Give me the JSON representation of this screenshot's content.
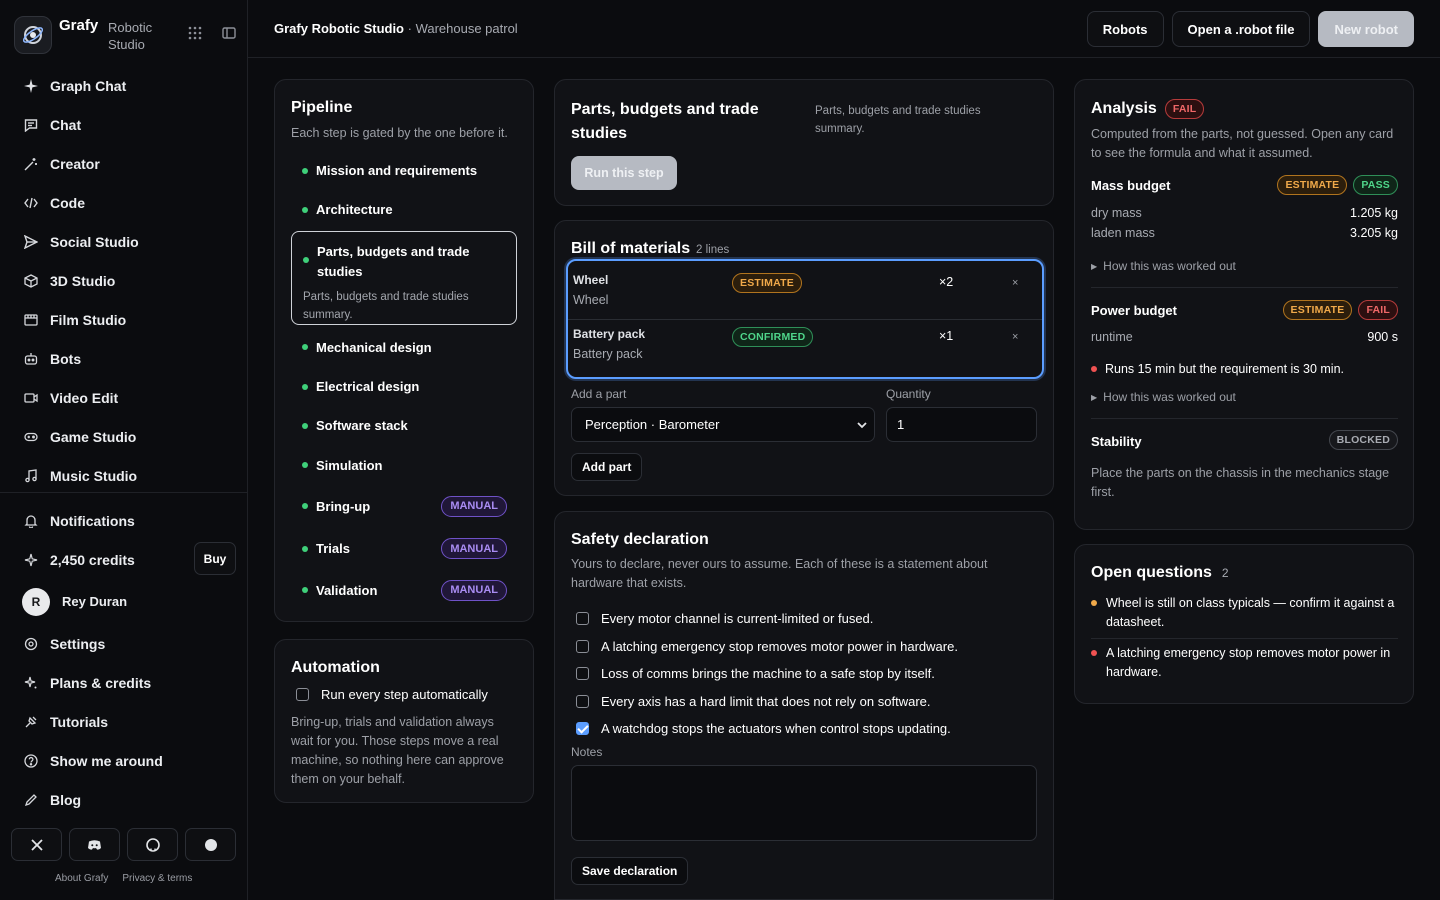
{
  "brand": {
    "name": "Grafy",
    "sub": "Robotic Studio"
  },
  "nav": [
    {
      "label": "Graph Chat",
      "icon": "sparkle-icon"
    },
    {
      "label": "Chat",
      "icon": "chat-icon"
    },
    {
      "label": "Creator",
      "icon": "wand-icon"
    },
    {
      "label": "Code",
      "icon": "code-icon"
    },
    {
      "label": "Social Studio",
      "icon": "send-icon"
    },
    {
      "label": "3D Studio",
      "icon": "cube-icon"
    },
    {
      "label": "Film Studio",
      "icon": "film-icon"
    },
    {
      "label": "Bots",
      "icon": "bot-icon"
    },
    {
      "label": "Video Edit",
      "icon": "video-icon"
    },
    {
      "label": "Game Studio",
      "icon": "gamepad-icon"
    },
    {
      "label": "Music Studio",
      "icon": "music-icon"
    }
  ],
  "nav2": {
    "notifications": "Notifications",
    "credits": "2,450 credits",
    "buy": "Buy",
    "user_initial": "R",
    "user_name": "Rey Duran",
    "settings": "Settings",
    "plans": "Plans & credits",
    "tutorials": "Tutorials",
    "tour": "Show me around",
    "blog": "Blog"
  },
  "footer": {
    "about": "About Grafy",
    "privacy": "Privacy & terms"
  },
  "header": {
    "app": "Grafy Robotic Studio",
    "sep": " · ",
    "project": "Warehouse patrol",
    "robots": "Robots",
    "open": "Open a .robot file",
    "new": "New robot"
  },
  "pipeline": {
    "title": "Pipeline",
    "desc": "Each step is gated by the one before it.",
    "steps": [
      {
        "label": "Mission and requirements"
      },
      {
        "label": "Architecture"
      },
      {
        "label": "Parts, budgets and trade studies",
        "desc": "Parts, budgets and trade studies summary."
      },
      {
        "label": "Mechanical design"
      },
      {
        "label": "Electrical design"
      },
      {
        "label": "Software stack"
      },
      {
        "label": "Simulation"
      },
      {
        "label": "Bring-up",
        "badge": "MANUAL"
      },
      {
        "label": "Trials",
        "badge": "MANUAL"
      },
      {
        "label": "Validation",
        "badge": "MANUAL"
      }
    ]
  },
  "automation": {
    "title": "Automation",
    "checkbox": "Run every step automatically",
    "checked": false,
    "desc": "Bring-up, trials and validation always wait for you. Those steps move a real machine, so nothing here can approve them on your behalf."
  },
  "parts": {
    "title": "Parts, budgets and trade studies",
    "desc": "Parts, budgets and trade studies summary.",
    "run": "Run this step"
  },
  "bom": {
    "title": "Bill of materials",
    "lines": "2 lines",
    "rows": [
      {
        "name": "Wheel",
        "sub": "Wheel",
        "status": "ESTIMATE",
        "qty": "×2",
        "remove": "×"
      },
      {
        "name": "Battery pack",
        "sub": "Battery pack",
        "status": "CONFIRMED",
        "qty": "×1",
        "remove": "×"
      }
    ],
    "add_label": "Add a part",
    "qty_label": "Quantity",
    "selected_part": "Perception · Barometer",
    "qty_value": "1",
    "add_button": "Add part"
  },
  "safety": {
    "title": "Safety declaration",
    "desc": "Yours to declare, never ours to assume. Each of these is a statement about hardware that exists.",
    "items": [
      {
        "label": "Every motor channel is current-limited or fused.",
        "checked": false
      },
      {
        "label": "A latching emergency stop removes motor power in hardware.",
        "checked": false
      },
      {
        "label": "Loss of comms brings the machine to a safe stop by itself.",
        "checked": false
      },
      {
        "label": "Every axis has a hard limit that does not rely on software.",
        "checked": false
      },
      {
        "label": "A watchdog stops the actuators when control stops updating.",
        "checked": true
      }
    ],
    "notes_label": "Notes",
    "notes_value": "",
    "save": "Save declaration"
  },
  "analysis": {
    "title": "Analysis",
    "status": "FAIL",
    "desc": "Computed from the parts, not guessed. Open any card to see the formula and what it assumed.",
    "mass": {
      "title": "Mass budget",
      "pill1": "ESTIMATE",
      "pill2": "PASS",
      "dry_label": "dry mass",
      "dry_value": "1.205 kg",
      "laden_label": "laden mass",
      "laden_value": "3.205 kg",
      "how": "How this was worked out"
    },
    "power": {
      "title": "Power budget",
      "pill1": "ESTIMATE",
      "pill2": "FAIL",
      "runtime_label": "runtime",
      "runtime_value": "900 s",
      "warning": "Runs 15 min but the requirement is 30 min.",
      "how": "How this was worked out"
    },
    "stability": {
      "title": "Stability",
      "pill": "BLOCKED",
      "desc": "Place the parts on the chassis in the mechanics stage first."
    }
  },
  "open_questions": {
    "title": "Open questions",
    "count": "2",
    "items": [
      {
        "text": "Wheel is still on class typicals — confirm it against a datasheet.",
        "color": "#f0a94a"
      },
      {
        "text": "A latching emergency stop removes motor power in hardware.",
        "color": "#f05252"
      }
    ]
  },
  "colors": {
    "accent": "#5b9dff",
    "ok": "#3fd07a",
    "estimate": "#f0a94a",
    "fail": "#f05252",
    "manual": "#a98cf2"
  }
}
